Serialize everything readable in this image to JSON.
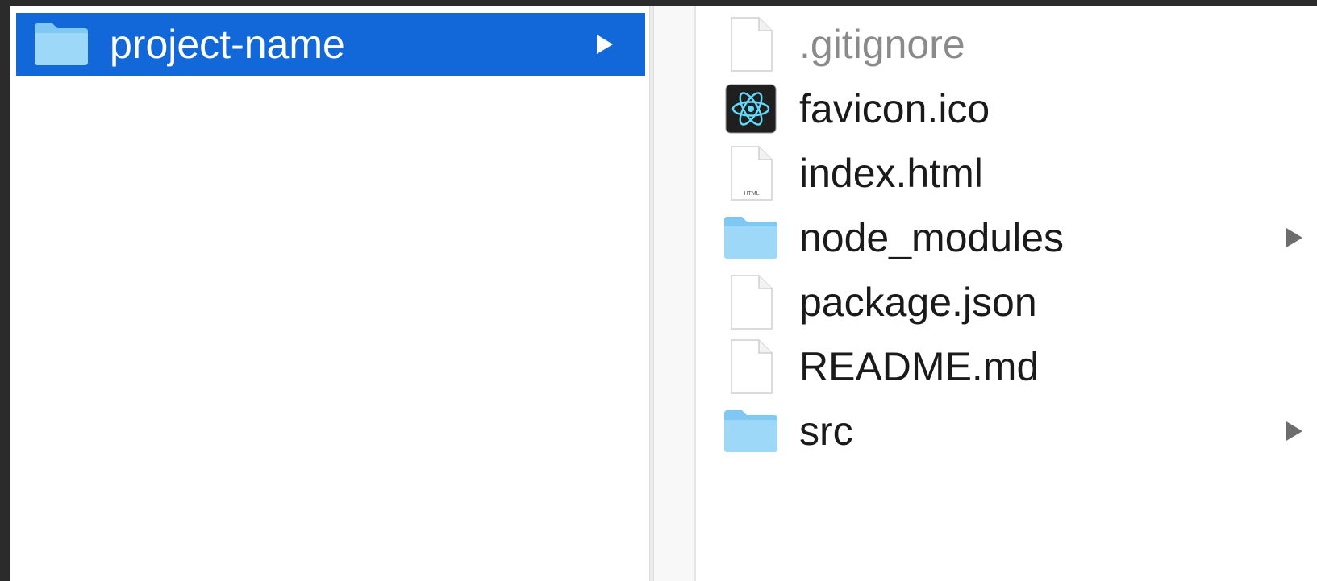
{
  "column1": {
    "items": [
      {
        "label": "project-name",
        "icon": "folder-icon",
        "selected": true
      }
    ]
  },
  "column2": {
    "items": [
      {
        "label": ".gitignore",
        "icon": "document-icon"
      },
      {
        "label": "favicon.ico",
        "icon": "react-icon"
      },
      {
        "label": "index.html",
        "icon": "html-file-icon",
        "icon_badge": "HTML"
      },
      {
        "label": "node_modules",
        "icon": "folder-icon"
      },
      {
        "label": "package.json",
        "icon": "document-icon"
      },
      {
        "label": "README.md",
        "icon": "document-icon"
      },
      {
        "label": "src",
        "icon": "folder-icon"
      }
    ]
  },
  "colors": {
    "selection": "#1268d8",
    "folder": "#7ec8f3",
    "react_bg": "#1f1f1f",
    "react_atom": "#61dafb",
    "background": "#2b2b2b"
  }
}
